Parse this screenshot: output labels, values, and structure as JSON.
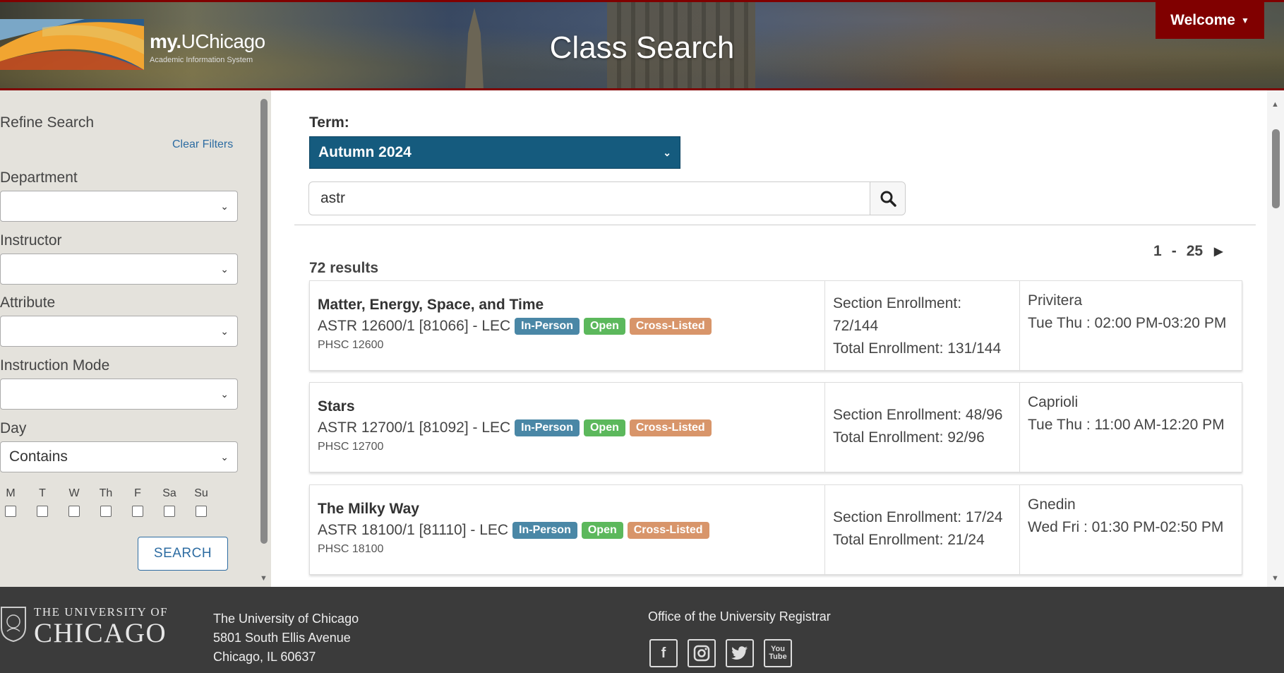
{
  "header": {
    "brand_bold": "my.",
    "brand_rest": "UChicago",
    "brand_sub": "Academic Information System",
    "title": "Class Search",
    "welcome": "Welcome"
  },
  "sidebar": {
    "refine": "Refine Search",
    "clear": "Clear Filters",
    "department_label": "Department",
    "department_value": "",
    "instructor_label": "Instructor",
    "instructor_value": "",
    "attribute_label": "Attribute",
    "attribute_value": "",
    "mode_label": "Instruction Mode",
    "mode_value": "",
    "day_label": "Day",
    "day_value": "Contains",
    "days": [
      "M",
      "T",
      "W",
      "Th",
      "F",
      "Sa",
      "Su"
    ],
    "search_btn": "SEARCH"
  },
  "main": {
    "term_label": "Term:",
    "term_value": "Autumn 2024",
    "search_value": "astr",
    "results": "72 results",
    "pager_from": "1",
    "pager_sep": "-",
    "pager_to": "25"
  },
  "courses": [
    {
      "title": "Matter, Energy, Space, and Time",
      "code": "ASTR 12600/1 [81066] - LEC",
      "badges": [
        "In-Person",
        "Open",
        "Cross-Listed"
      ],
      "cross": "PHSC 12600",
      "enroll_1": "Section Enrollment:",
      "enroll_2": "72/144",
      "enroll_3": "Total Enrollment: 131/144",
      "instructor": "Privitera",
      "time": "Tue Thu : 02:00 PM-03:20 PM"
    },
    {
      "title": "Stars",
      "code": "ASTR 12700/1 [81092] - LEC",
      "badges": [
        "In-Person",
        "Open",
        "Cross-Listed"
      ],
      "cross": "PHSC 12700",
      "enroll_1": "Section Enrollment: 48/96",
      "enroll_2": "Total Enrollment: 92/96",
      "enroll_3": "",
      "instructor": "Caprioli",
      "time": "Tue Thu : 11:00 AM-12:20 PM"
    },
    {
      "title": "The Milky Way",
      "code": "ASTR 18100/1 [81110] - LEC",
      "badges": [
        "In-Person",
        "Open",
        "Cross-Listed"
      ],
      "cross": "PHSC 18100",
      "enroll_1": "Section Enrollment: 17/24",
      "enroll_2": "Total Enrollment: 21/24",
      "enroll_3": "",
      "instructor": "Gnedin",
      "time": "Wed Fri : 01:30 PM-02:50 PM"
    }
  ],
  "footer": {
    "uc_top": "THE UNIVERSITY OF",
    "uc_big": "CHICAGO",
    "addr_1": "The University of Chicago",
    "addr_2": "5801 South Ellis Avenue",
    "addr_3": "Chicago, IL 60637",
    "office": "Office of the University Registrar",
    "social": [
      "facebook-icon",
      "instagram-icon",
      "twitter-icon",
      "youtube-icon"
    ]
  },
  "colors": {
    "maroon": "#800000",
    "term_blue": "#155b7e",
    "badge_mode": "#4a87a6",
    "badge_open": "#5cb85c",
    "badge_cross": "#d8956a"
  }
}
